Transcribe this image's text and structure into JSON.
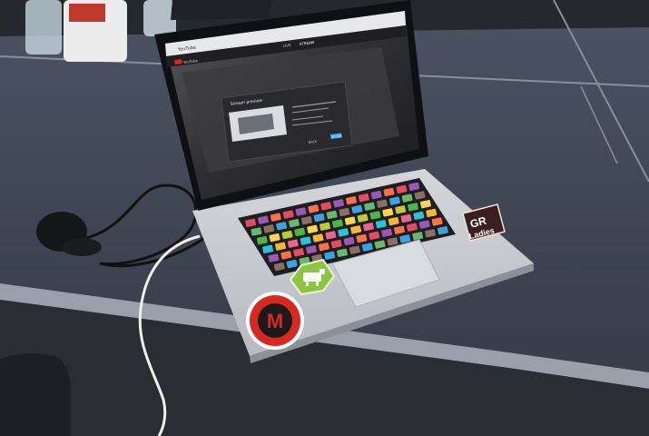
{
  "photo": {
    "laptop_screen": {
      "browser_tabs": [
        "YouTube"
      ],
      "site_logo_text": "YouTube",
      "header_tabs": [
        "LIVE",
        "STREAM"
      ],
      "dialog": {
        "title": "Stream preview",
        "buttons": [
          "BACK",
          "GO LIVE"
        ]
      }
    },
    "stickers": {
      "gr_ladies": {
        "line1": "GR",
        "line2": "Ladies"
      },
      "green_hex": {
        "icon": "cow-icon"
      },
      "red_circle": {
        "letter": "M"
      }
    },
    "colors": {
      "table": "#3d4451",
      "laptop_body": "#c9ccd2",
      "screen_bezel": "#0f1013",
      "red_sticker": "#d8281f",
      "green_sticker": "#8cc63f",
      "gr_sticker": "#3b1f1f",
      "chair": "#1c1f24"
    }
  }
}
